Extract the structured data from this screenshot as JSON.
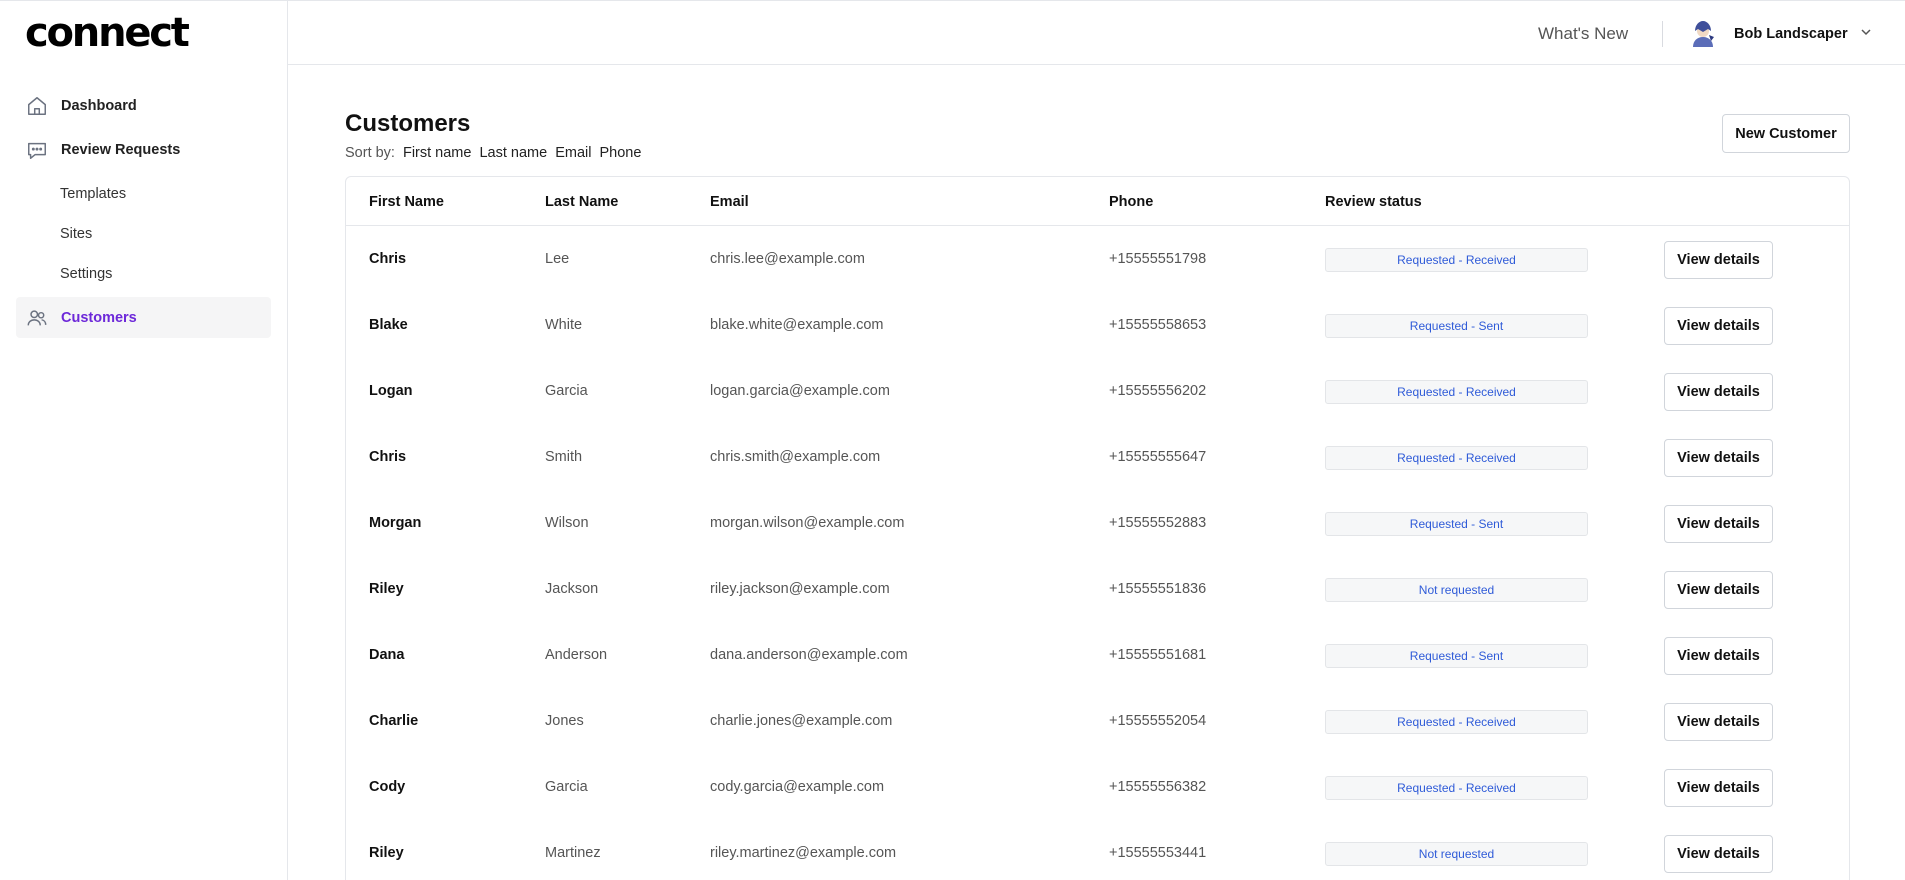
{
  "brand": {
    "logo_text": "connect",
    "accent": "#6d28d9"
  },
  "sidebar": {
    "items": [
      {
        "label": "Dashboard",
        "icon": "home-icon"
      },
      {
        "label": "Review Requests",
        "icon": "chat-bubble-icon"
      },
      {
        "label": "Customers",
        "icon": "users-icon",
        "active": true
      }
    ],
    "subitems": [
      {
        "label": "Templates"
      },
      {
        "label": "Sites"
      },
      {
        "label": "Settings"
      }
    ]
  },
  "header": {
    "whats_new": "What's New",
    "user_name": "Bob Landscaper",
    "user_icon": "avatar-icon"
  },
  "page": {
    "title": "Customers",
    "sort_label": "Sort by:",
    "sort_options": [
      "First name",
      "Last name",
      "Email",
      "Phone"
    ],
    "new_customer_label": "New Customer"
  },
  "table": {
    "headers": [
      "First Name",
      "Last Name",
      "Email",
      "Phone",
      "Review status"
    ],
    "action_label": "View details",
    "rows": [
      {
        "first": "Chris",
        "last": "Lee",
        "email": "chris.lee@example.com",
        "phone": "+15555551798",
        "status": "Requested - Received"
      },
      {
        "first": "Blake",
        "last": "White",
        "email": "blake.white@example.com",
        "phone": "+15555558653",
        "status": "Requested - Sent"
      },
      {
        "first": "Logan",
        "last": "Garcia",
        "email": "logan.garcia@example.com",
        "phone": "+15555556202",
        "status": "Requested - Received"
      },
      {
        "first": "Chris",
        "last": "Smith",
        "email": "chris.smith@example.com",
        "phone": "+15555555647",
        "status": "Requested - Received"
      },
      {
        "first": "Morgan",
        "last": "Wilson",
        "email": "morgan.wilson@example.com",
        "phone": "+15555552883",
        "status": "Requested - Sent"
      },
      {
        "first": "Riley",
        "last": "Jackson",
        "email": "riley.jackson@example.com",
        "phone": "+15555551836",
        "status": "Not requested"
      },
      {
        "first": "Dana",
        "last": "Anderson",
        "email": "dana.anderson@example.com",
        "phone": "+15555551681",
        "status": "Requested - Sent"
      },
      {
        "first": "Charlie",
        "last": "Jones",
        "email": "charlie.jones@example.com",
        "phone": "+15555552054",
        "status": "Requested - Received"
      },
      {
        "first": "Cody",
        "last": "Garcia",
        "email": "cody.garcia@example.com",
        "phone": "+15555556382",
        "status": "Requested - Received"
      },
      {
        "first": "Riley",
        "last": "Martinez",
        "email": "riley.martinez@example.com",
        "phone": "+15555553441",
        "status": "Not requested"
      }
    ]
  }
}
